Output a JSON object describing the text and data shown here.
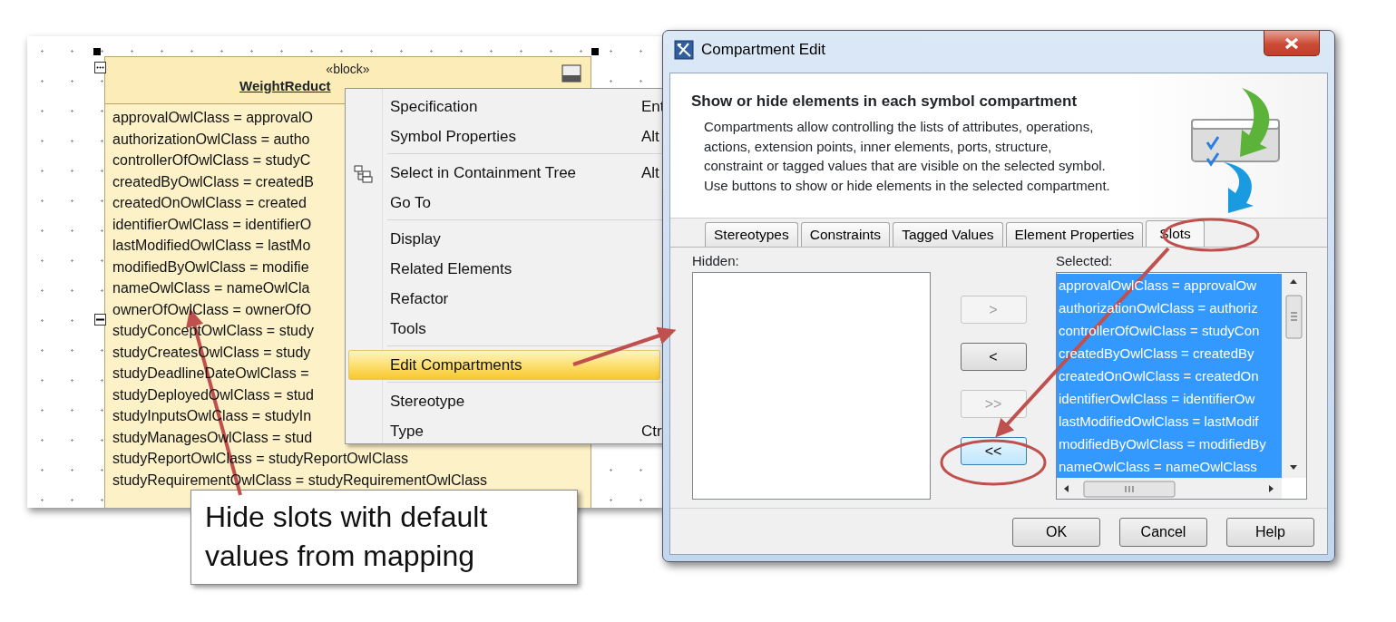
{
  "diagram": {
    "block": {
      "stereotype": "«block»",
      "name": "WeightReduct",
      "slots": [
        "approvalOwlClass = approvalO",
        "authorizationOwlClass = autho",
        "controllerOfOwlClass = studyC",
        "createdByOwlClass = createdB",
        "createdOnOwlClass = created",
        "identifierOwlClass = identifierO",
        "lastModifiedOwlClass = lastMo",
        "modifiedByOwlClass = modifie",
        "nameOwlClass = nameOwlCla",
        "ownerOfOwlClass = ownerOfO",
        "studyConceptOwlClass = study",
        "studyCreatesOwlClass = study",
        "studyDeadlineDateOwlClass =",
        "studyDeployedOwlClass = stud",
        "studyInputsOwlClass = studyIn",
        "studyManagesOwlClass = stud",
        "studyReportOwlClass = studyReportOwlClass",
        "studyRequirementOwlClass = studyRequirementOwlClass"
      ]
    }
  },
  "context_menu": {
    "items": [
      {
        "kind": "item",
        "label": "Specification",
        "shortcut": "Ent",
        "highlighted": false
      },
      {
        "kind": "item",
        "label": "Symbol Properties",
        "shortcut": "Alt",
        "highlighted": false
      },
      {
        "kind": "separator"
      },
      {
        "kind": "item",
        "label": "Select in Containment Tree",
        "shortcut": "Alt",
        "highlighted": false,
        "has_icon": true
      },
      {
        "kind": "item",
        "label": "Go To",
        "highlighted": false
      },
      {
        "kind": "separator"
      },
      {
        "kind": "item",
        "label": "Display",
        "highlighted": false
      },
      {
        "kind": "item",
        "label": "Related Elements",
        "highlighted": false
      },
      {
        "kind": "item",
        "label": "Refactor",
        "highlighted": false
      },
      {
        "kind": "item",
        "label": "Tools",
        "highlighted": false
      },
      {
        "kind": "separator"
      },
      {
        "kind": "item",
        "label": "Edit Compartments",
        "highlighted": true
      },
      {
        "kind": "separator"
      },
      {
        "kind": "item",
        "label": "Stereotype",
        "highlighted": false
      },
      {
        "kind": "item",
        "label": "Type",
        "shortcut": "Ctr",
        "highlighted": false
      }
    ]
  },
  "dialog": {
    "title": "Compartment Edit",
    "heading": "Show or hide elements in each symbol compartment",
    "description": [
      "Compartments allow controlling the lists of attributes, operations,",
      "actions, extension points, inner elements, ports, structure,",
      "constraint or tagged values that are visible on the selected symbol.",
      "Use buttons to show or hide elements in the selected compartment."
    ],
    "tabs": [
      {
        "label": "Stereotypes",
        "selected": false
      },
      {
        "label": "Constraints",
        "selected": false
      },
      {
        "label": "Tagged Values",
        "selected": false
      },
      {
        "label": "Element Properties",
        "selected": false
      },
      {
        "label": "Slots",
        "selected": true
      }
    ],
    "hidden_label": "Hidden:",
    "selected_label": "Selected:",
    "selected_items": [
      {
        "label": "approvalOwlClass = approvalOw",
        "selected": true
      },
      {
        "label": "authorizationOwlClass = authoriz",
        "selected": true
      },
      {
        "label": "controllerOfOwlClass = studyCon",
        "selected": true
      },
      {
        "label": "createdByOwlClass = createdBy",
        "selected": true
      },
      {
        "label": "createdOnOwlClass = createdOn",
        "selected": true
      },
      {
        "label": "identifierOwlClass = identifierOw",
        "selected": true
      },
      {
        "label": "lastModifiedOwlClass = lastModif",
        "selected": true
      },
      {
        "label": "modifiedByOwlClass = modifiedBy",
        "selected": true
      },
      {
        "label": "nameOwlClass = nameOwlClass",
        "selected": true
      }
    ],
    "transfer_buttons": [
      {
        "label": ">",
        "disabled": true
      },
      {
        "label": "<",
        "disabled": false
      },
      {
        "label": ">>",
        "disabled": true
      },
      {
        "label": "<<",
        "disabled": false,
        "focused": true
      }
    ],
    "buttons": [
      "OK",
      "Cancel",
      "Help"
    ]
  },
  "callout": {
    "text": "Hide slots with default values from mapping"
  }
}
